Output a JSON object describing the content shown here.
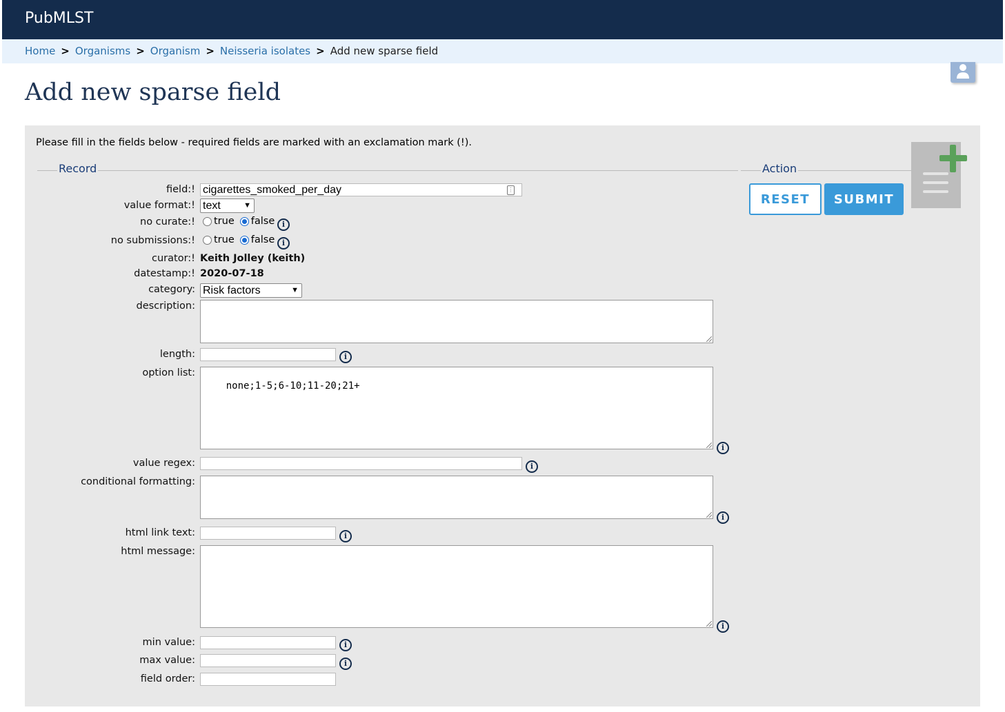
{
  "app": {
    "brand": "PubMLST"
  },
  "breadcrumb": {
    "items": [
      "Home",
      "Organisms",
      "Organism",
      "Neisseria isolates"
    ],
    "current": "Add new sparse field",
    "separator": ">"
  },
  "page": {
    "title": "Add new sparse field"
  },
  "intro": "Please fill in the fields below - required fields are marked with an exclamation mark (!).",
  "sections": {
    "record": "Record",
    "action": "Action"
  },
  "form": {
    "field": {
      "label": "field:!",
      "value": "cigarettes_smoked_per_day"
    },
    "value_format": {
      "label": "value format:!",
      "value": "text"
    },
    "no_curate": {
      "label": "no curate:!",
      "true_label": "true",
      "false_label": "false",
      "selected": "false"
    },
    "no_submissions": {
      "label": "no submissions:!",
      "true_label": "true",
      "false_label": "false",
      "selected": "false"
    },
    "curator": {
      "label": "curator:!",
      "value": "Keith Jolley (keith)"
    },
    "datestamp": {
      "label": "datestamp:!",
      "value": "2020-07-18"
    },
    "category": {
      "label": "category:",
      "value": "Risk factors"
    },
    "description": {
      "label": "description:",
      "value": ""
    },
    "length": {
      "label": "length:",
      "value": ""
    },
    "option_list": {
      "label": "option list:",
      "value": "none;1-5;6-10;11-20;21+"
    },
    "value_regex": {
      "label": "value regex:",
      "value": ""
    },
    "conditional_formatting": {
      "label": "conditional formatting:",
      "value": ""
    },
    "html_link_text": {
      "label": "html link text:",
      "value": ""
    },
    "html_message": {
      "label": "html message:",
      "value": ""
    },
    "min_value": {
      "label": "min value:",
      "value": ""
    },
    "max_value": {
      "label": "max value:",
      "value": ""
    },
    "field_order": {
      "label": "field order:",
      "value": ""
    }
  },
  "actions": {
    "reset": "RESET",
    "submit": "SUBMIT"
  },
  "icons": {
    "user": "user-icon",
    "info": "info-icon",
    "add_document": "add-document-icon",
    "key": "key-icon",
    "info_glyph": "i"
  },
  "colors": {
    "topbar": "#142c4c",
    "breadcrumb_bg": "#e8f2fc",
    "link": "#2a6fa8",
    "button": "#3a9ad9",
    "panel_bg": "#e8e8e8",
    "add_icon_green": "#5aa15a"
  }
}
